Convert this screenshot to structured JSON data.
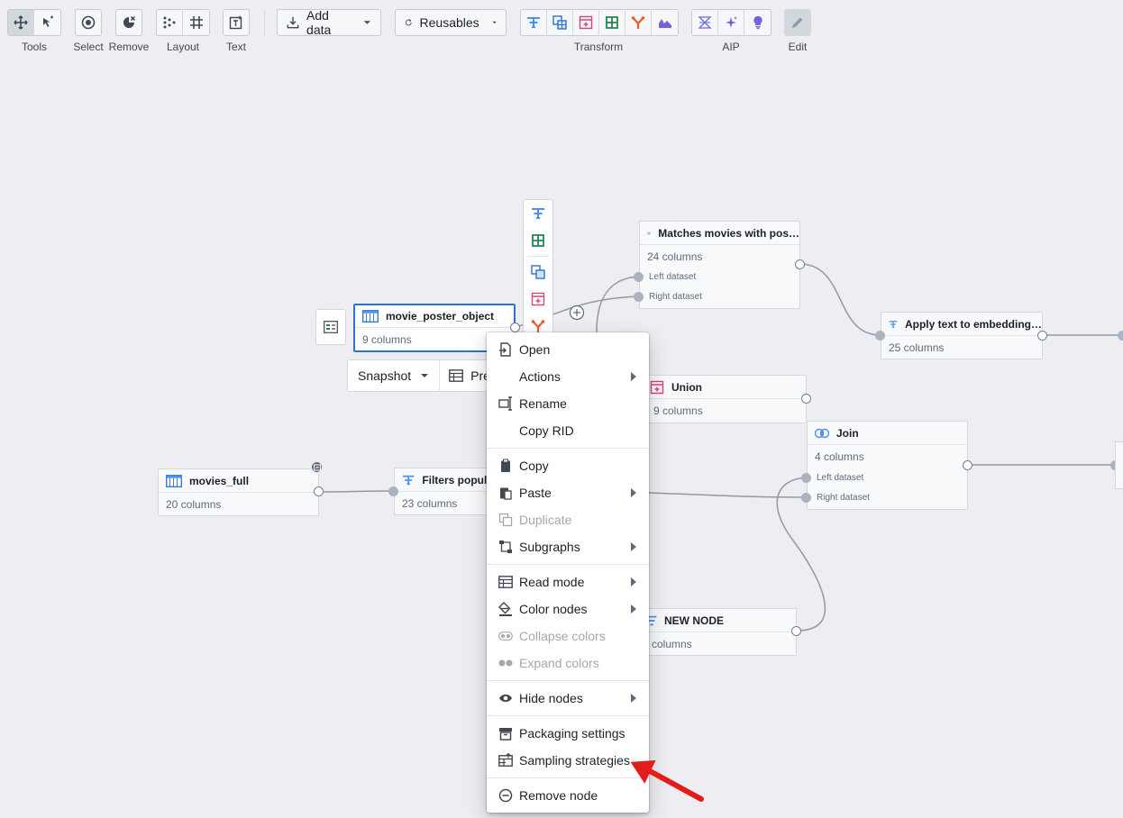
{
  "toolbar": {
    "labels": {
      "tools": "Tools",
      "select": "Select",
      "remove": "Remove",
      "layout": "Layout",
      "text": "Text",
      "transform": "Transform",
      "aip": "AIP",
      "edit": "Edit"
    },
    "add_data": "Add data",
    "reusables": "Reusables"
  },
  "nodes": {
    "matches": {
      "title": "Matches movies with pos…",
      "columns": "24 columns",
      "left": "Left dataset",
      "right": "Right dataset"
    },
    "apply_text": {
      "title": "Apply text to embedding…",
      "columns": "25 columns"
    },
    "movie_poster": {
      "title": "movie_poster_object",
      "columns": "9 columns"
    },
    "union": {
      "title": "Union",
      "columns": "9 columns"
    },
    "join": {
      "title": "Join",
      "columns": "4 columns",
      "left": "Left dataset",
      "right": "Right dataset"
    },
    "movies_full": {
      "title": "movies_full",
      "columns": "20 columns"
    },
    "filters": {
      "title": "Filters popula",
      "columns": "23 columns"
    },
    "new_node": {
      "title": "NEW NODE",
      "columns": "columns"
    }
  },
  "snapshot_bar": {
    "snapshot": "Snapshot",
    "preview": "Pre"
  },
  "context_menu": {
    "open": "Open",
    "actions": "Actions",
    "rename": "Rename",
    "copy_rid": "Copy RID",
    "copy": "Copy",
    "paste": "Paste",
    "duplicate": "Duplicate",
    "subgraphs": "Subgraphs",
    "read_mode": "Read mode",
    "color_nodes": "Color nodes",
    "collapse_colors": "Collapse colors",
    "expand_colors": "Expand colors",
    "hide_nodes": "Hide nodes",
    "packaging_settings": "Packaging settings",
    "sampling_strategies": "Sampling strategies",
    "remove_node": "Remove node"
  },
  "colors": {
    "accent": "#2d72d2",
    "annotation_arrow": "#e31b1b",
    "filter_blue": "#4c90f0",
    "join_green": "#238551",
    "union_pink": "#d1467b",
    "split_orange": "#ec5b2a",
    "aip_purple": "#7961db"
  }
}
